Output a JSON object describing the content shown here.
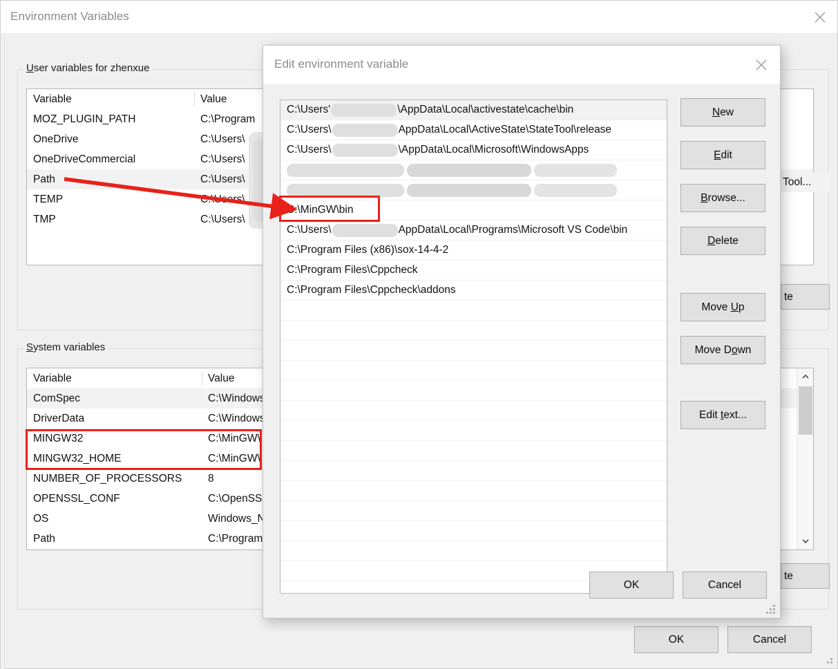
{
  "base_window": {
    "title": "Environment Variables",
    "close_icon": "close-icon",
    "user_group": {
      "legend_mnemonic": "U",
      "legend_rest": "ser variables for zhenxue",
      "columns": [
        "Variable",
        "Value"
      ],
      "rows": [
        {
          "variable": "MOZ_PLUGIN_PATH",
          "value": "C:\\Program",
          "selected": false
        },
        {
          "variable": "OneDrive",
          "value": "C:\\Users\\",
          "selected": false
        },
        {
          "variable": "OneDriveCommercial",
          "value": "C:\\Users\\",
          "selected": false
        },
        {
          "variable": "Path",
          "value": "C:\\Users\\",
          "selected": true
        },
        {
          "variable": "TEMP",
          "value": "C:\\Users\\",
          "selected": false
        },
        {
          "variable": "TMP",
          "value": "C:\\Users\\",
          "selected": false
        }
      ],
      "occluded_button_label": "Tool..."
    },
    "system_group": {
      "legend_mnemonic": "S",
      "legend_rest": "ystem variables",
      "columns": [
        "Variable",
        "Value"
      ],
      "rows": [
        {
          "variable": "ComSpec",
          "value": "C:\\Windows",
          "selected": true
        },
        {
          "variable": "DriverData",
          "value": "C:\\Windows",
          "selected": false
        },
        {
          "variable": "MINGW32",
          "value": "C:\\MinGW\\",
          "selected": false
        },
        {
          "variable": "MINGW32_HOME",
          "value": "C:\\MinGW\\",
          "selected": false
        },
        {
          "variable": "NUMBER_OF_PROCESSORS",
          "value": "8",
          "selected": false
        },
        {
          "variable": "OPENSSL_CONF",
          "value": "C:\\OpenSSL",
          "selected": false
        },
        {
          "variable": "OS",
          "value": "Windows_N",
          "selected": false
        },
        {
          "variable": "Path",
          "value": "C:\\Program",
          "selected": false
        }
      ]
    },
    "occluded_delete_label": "te",
    "ok_label": "OK",
    "cancel_label": "Cancel"
  },
  "edit_dialog": {
    "title": "Edit environment variable",
    "close_icon": "close-icon",
    "path_entries": [
      {
        "text": "C:\\Users'",
        "redacted_after": true,
        "tail": "\\AppData\\Local\\activestate\\cache\\bin",
        "selected": true,
        "fully_redacted": false
      },
      {
        "text": "C:\\Users\\",
        "redacted_after": true,
        "tail": "AppData\\Local\\ActiveState\\StateTool\\release",
        "selected": false,
        "fully_redacted": false
      },
      {
        "text": "C:\\Users\\",
        "redacted_after": true,
        "tail": "\\AppData\\Local\\Microsoft\\WindowsApps",
        "selected": false,
        "fully_redacted": false
      },
      {
        "text": "",
        "redacted_after": false,
        "tail": "",
        "selected": false,
        "fully_redacted": true
      },
      {
        "text": "",
        "redacted_after": false,
        "tail": "",
        "selected": false,
        "fully_redacted": true
      },
      {
        "text": "C:\\MinGW\\bin",
        "redacted_after": false,
        "tail": "",
        "selected": false,
        "fully_redacted": false,
        "highlighted": true
      },
      {
        "text": "C:\\Users\\",
        "redacted_after": true,
        "tail": "AppData\\Local\\Programs\\Microsoft VS Code\\bin",
        "selected": false,
        "fully_redacted": false
      },
      {
        "text": "C:\\Program Files (x86)\\sox-14-4-2",
        "redacted_after": false,
        "tail": "",
        "selected": false,
        "fully_redacted": false
      },
      {
        "text": "C:\\Program Files\\Cppcheck",
        "redacted_after": false,
        "tail": "",
        "selected": false,
        "fully_redacted": false
      },
      {
        "text": "C:\\Program Files\\Cppcheck\\addons",
        "redacted_after": false,
        "tail": "",
        "selected": false,
        "fully_redacted": false
      }
    ],
    "side_buttons": [
      {
        "mnemonic": "N",
        "rest": "ew",
        "pre": "",
        "name": "new-button"
      },
      {
        "mnemonic": "E",
        "rest": "dit",
        "pre": "",
        "name": "edit-button"
      },
      {
        "mnemonic": "B",
        "rest": "rowse...",
        "pre": "",
        "name": "browse-button"
      },
      {
        "mnemonic": "D",
        "rest": "elete",
        "pre": "",
        "name": "delete-button"
      },
      {
        "mnemonic": "U",
        "rest": "p",
        "pre": "Move ",
        "name": "move-up-button"
      },
      {
        "mnemonic": "o",
        "rest": "wn",
        "pre": "Move D",
        "name": "move-down-button"
      },
      {
        "mnemonic": "t",
        "rest": "ext...",
        "pre": "Edit ",
        "name": "edit-text-button"
      }
    ],
    "ok_label": "OK",
    "cancel_label": "Cancel"
  },
  "colors": {
    "annotation_red": "#e8211a",
    "dialog_bg": "#f0f0f0",
    "button_bg": "#e1e1e1",
    "selected_row": "#f2f2f2"
  }
}
